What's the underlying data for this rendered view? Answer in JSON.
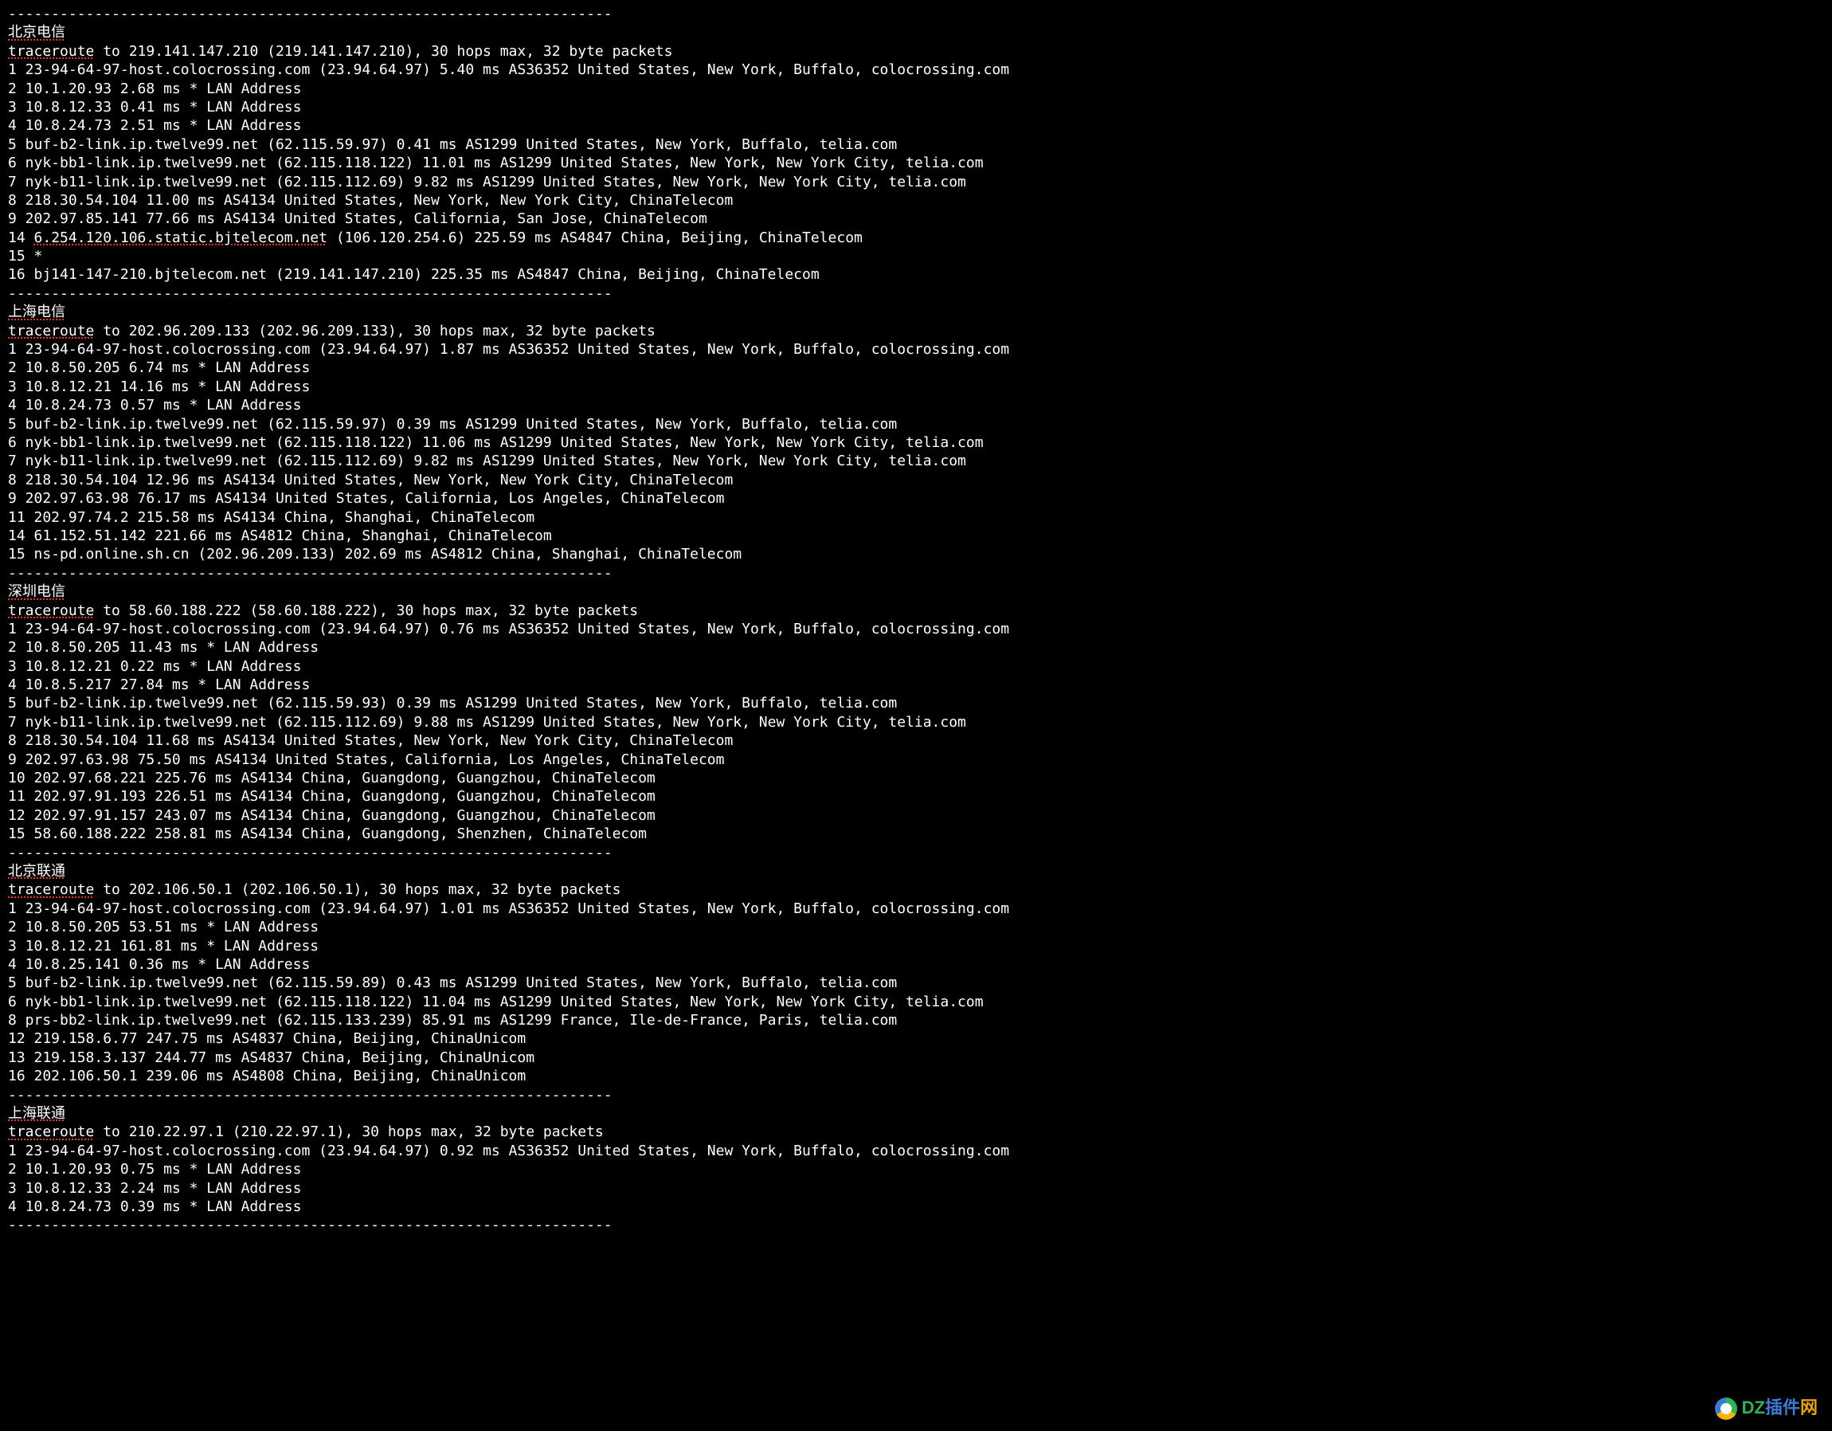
{
  "divider": "----------------------------------------------------------------------",
  "watermark": {
    "p1": "DZ",
    "p2": "插件",
    "p3": "网"
  },
  "sections": [
    {
      "title": "北京电信",
      "trace_to": "traceroute to 219.141.147.210 (219.141.147.210), 30 hops max, 32 byte packets",
      "hops": [
        "1 23-94-64-97-host.colocrossing.com (23.94.64.97) 5.40 ms AS36352 United States, New York, Buffalo, colocrossing.com",
        "2 10.1.20.93 2.68 ms * LAN Address",
        "3 10.8.12.33 0.41 ms * LAN Address",
        "4 10.8.24.73 2.51 ms * LAN Address",
        "5 buf-b2-link.ip.twelve99.net (62.115.59.97) 0.41 ms AS1299 United States, New York, Buffalo, telia.com",
        "6 nyk-bb1-link.ip.twelve99.net (62.115.118.122) 11.01 ms AS1299 United States, New York, New York City, telia.com",
        "7 nyk-b11-link.ip.twelve99.net (62.115.112.69) 9.82 ms AS1299 United States, New York, New York City, telia.com",
        "8 218.30.54.104 11.00 ms AS4134 United States, New York, New York City, ChinaTelecom",
        "9 202.97.85.141 77.66 ms AS4134 United States, California, San Jose, ChinaTelecom",
        {
          "prefix": "14 ",
          "underlined": "6.254.120.106.static.bjtelecom.net",
          "suffix": " (106.120.254.6) 225.59 ms AS4847 China, Beijing, ChinaTelecom"
        },
        "15 *",
        "16 bj141-147-210.bjtelecom.net (219.141.147.210) 225.35 ms AS4847 China, Beijing, ChinaTelecom"
      ]
    },
    {
      "title": "上海电信",
      "trace_to": "traceroute to 202.96.209.133 (202.96.209.133), 30 hops max, 32 byte packets",
      "hops": [
        "1 23-94-64-97-host.colocrossing.com (23.94.64.97) 1.87 ms AS36352 United States, New York, Buffalo, colocrossing.com",
        "2 10.8.50.205 6.74 ms * LAN Address",
        "3 10.8.12.21 14.16 ms * LAN Address",
        "4 10.8.24.73 0.57 ms * LAN Address",
        "5 buf-b2-link.ip.twelve99.net (62.115.59.97) 0.39 ms AS1299 United States, New York, Buffalo, telia.com",
        "6 nyk-bb1-link.ip.twelve99.net (62.115.118.122) 11.06 ms AS1299 United States, New York, New York City, telia.com",
        "7 nyk-b11-link.ip.twelve99.net (62.115.112.69) 9.82 ms AS1299 United States, New York, New York City, telia.com",
        "8 218.30.54.104 12.96 ms AS4134 United States, New York, New York City, ChinaTelecom",
        "9 202.97.63.98 76.17 ms AS4134 United States, California, Los Angeles, ChinaTelecom",
        "11 202.97.74.2 215.58 ms AS4134 China, Shanghai, ChinaTelecom",
        "14 61.152.51.142 221.66 ms AS4812 China, Shanghai, ChinaTelecom",
        "15 ns-pd.online.sh.cn (202.96.209.133) 202.69 ms AS4812 China, Shanghai, ChinaTelecom"
      ]
    },
    {
      "title": "深圳电信",
      "trace_to": "traceroute to 58.60.188.222 (58.60.188.222), 30 hops max, 32 byte packets",
      "hops": [
        "1 23-94-64-97-host.colocrossing.com (23.94.64.97) 0.76 ms AS36352 United States, New York, Buffalo, colocrossing.com",
        "2 10.8.50.205 11.43 ms * LAN Address",
        "3 10.8.12.21 0.22 ms * LAN Address",
        "4 10.8.5.217 27.84 ms * LAN Address",
        "5 buf-b2-link.ip.twelve99.net (62.115.59.93) 0.39 ms AS1299 United States, New York, Buffalo, telia.com",
        "7 nyk-b11-link.ip.twelve99.net (62.115.112.69) 9.88 ms AS1299 United States, New York, New York City, telia.com",
        "8 218.30.54.104 11.68 ms AS4134 United States, New York, New York City, ChinaTelecom",
        "9 202.97.63.98 75.50 ms AS4134 United States, California, Los Angeles, ChinaTelecom",
        "10 202.97.68.221 225.76 ms AS4134 China, Guangdong, Guangzhou, ChinaTelecom",
        "11 202.97.91.193 226.51 ms AS4134 China, Guangdong, Guangzhou, ChinaTelecom",
        "12 202.97.91.157 243.07 ms AS4134 China, Guangdong, Guangzhou, ChinaTelecom",
        "15 58.60.188.222 258.81 ms AS4134 China, Guangdong, Shenzhen, ChinaTelecom"
      ]
    },
    {
      "title": "北京联通",
      "trace_to": "traceroute to 202.106.50.1 (202.106.50.1), 30 hops max, 32 byte packets",
      "hops": [
        "1 23-94-64-97-host.colocrossing.com (23.94.64.97) 1.01 ms AS36352 United States, New York, Buffalo, colocrossing.com",
        "2 10.8.50.205 53.51 ms * LAN Address",
        "3 10.8.12.21 161.81 ms * LAN Address",
        "4 10.8.25.141 0.36 ms * LAN Address",
        "5 buf-b2-link.ip.twelve99.net (62.115.59.89) 0.43 ms AS1299 United States, New York, Buffalo, telia.com",
        "6 nyk-bb1-link.ip.twelve99.net (62.115.118.122) 11.04 ms AS1299 United States, New York, New York City, telia.com",
        "8 prs-bb2-link.ip.twelve99.net (62.115.133.239) 85.91 ms AS1299 France, Ile-de-France, Paris, telia.com",
        "12 219.158.6.77 247.75 ms AS4837 China, Beijing, ChinaUnicom",
        "13 219.158.3.137 244.77 ms AS4837 China, Beijing, ChinaUnicom",
        "16 202.106.50.1 239.06 ms AS4808 China, Beijing, ChinaUnicom"
      ]
    },
    {
      "title": "上海联通",
      "trace_to": "traceroute to 210.22.97.1 (210.22.97.1), 30 hops max, 32 byte packets",
      "hops": [
        "1 23-94-64-97-host.colocrossing.com (23.94.64.97) 0.92 ms AS36352 United States, New York, Buffalo, colocrossing.com",
        "2 10.1.20.93 0.75 ms * LAN Address",
        "3 10.8.12.33 2.24 ms * LAN Address",
        "4 10.8.24.73 0.39 ms * LAN Address"
      ]
    }
  ]
}
